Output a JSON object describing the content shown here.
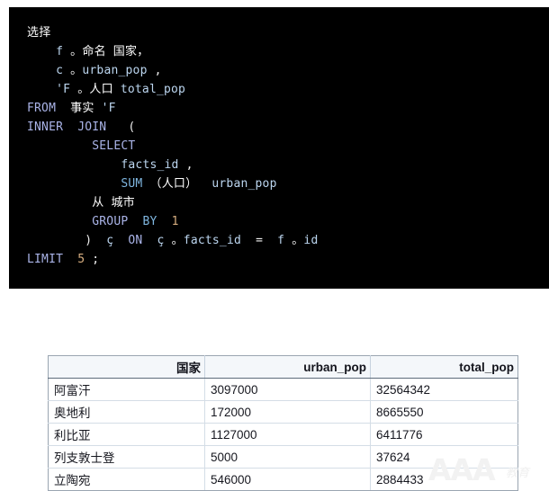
{
  "code_block": {
    "language": "sql",
    "background": "#000000",
    "lines": [
      [
        {
          "t": "选择",
          "c": "tk-cn"
        }
      ],
      [
        {
          "t": "    ",
          "c": "tk-punc"
        },
        {
          "t": "f",
          "c": "tk-id"
        },
        {
          "t": " 。",
          "c": "tk-cn"
        },
        {
          "t": "命名 国家，",
          "c": "tk-cn"
        }
      ],
      [
        {
          "t": "    ",
          "c": "tk-punc"
        },
        {
          "t": "c",
          "c": "tk-id"
        },
        {
          "t": " 。",
          "c": "tk-cn"
        },
        {
          "t": "urban_pop",
          "c": "tk-id"
        },
        {
          "t": " ,",
          "c": "tk-punc"
        }
      ],
      [
        {
          "t": "    ",
          "c": "tk-punc"
        },
        {
          "t": "'F",
          "c": "tk-id"
        },
        {
          "t": " 。",
          "c": "tk-cn"
        },
        {
          "t": "人口",
          "c": "tk-cn"
        },
        {
          "t": " ",
          "c": "tk-punc"
        },
        {
          "t": "total_pop",
          "c": "tk-id"
        }
      ],
      [
        {
          "t": "FROM",
          "c": "tk-kw"
        },
        {
          "t": "  ",
          "c": "tk-punc"
        },
        {
          "t": "事实",
          "c": "tk-cn"
        },
        {
          "t": " ",
          "c": "tk-punc"
        },
        {
          "t": "'F",
          "c": "tk-id"
        }
      ],
      [
        {
          "t": "INNER",
          "c": "tk-kw"
        },
        {
          "t": "  ",
          "c": "tk-punc"
        },
        {
          "t": "JOIN",
          "c": "tk-kw"
        },
        {
          "t": "   (",
          "c": "tk-punc"
        }
      ],
      [
        {
          "t": "         ",
          "c": "tk-punc"
        },
        {
          "t": "SELECT",
          "c": "tk-kw"
        }
      ],
      [
        {
          "t": "             ",
          "c": "tk-punc"
        },
        {
          "t": "facts_id",
          "c": "tk-id"
        },
        {
          "t": " ,",
          "c": "tk-punc"
        }
      ],
      [
        {
          "t": "             ",
          "c": "tk-punc"
        },
        {
          "t": "SUM",
          "c": "tk-kw2"
        },
        {
          "t": " （",
          "c": "tk-cn"
        },
        {
          "t": "人口",
          "c": "tk-cn"
        },
        {
          "t": "）",
          "c": "tk-cn"
        },
        {
          "t": "  ",
          "c": "tk-punc"
        },
        {
          "t": "urban_pop",
          "c": "tk-id"
        }
      ],
      [
        {
          "t": "         ",
          "c": "tk-punc"
        },
        {
          "t": "从 城市",
          "c": "tk-cn"
        }
      ],
      [
        {
          "t": "         ",
          "c": "tk-punc"
        },
        {
          "t": "GROUP",
          "c": "tk-kw"
        },
        {
          "t": "  ",
          "c": "tk-punc"
        },
        {
          "t": "BY",
          "c": "tk-kw2"
        },
        {
          "t": "  ",
          "c": "tk-punc"
        },
        {
          "t": "1",
          "c": "tk-num"
        }
      ],
      [
        {
          "t": "        ",
          "c": "tk-punc"
        },
        {
          "t": ")",
          "c": "tk-punc"
        },
        {
          "t": "  ç",
          "c": "tk-id"
        },
        {
          "t": "  ",
          "c": "tk-punc"
        },
        {
          "t": "ON",
          "c": "tk-kw"
        },
        {
          "t": "  ç",
          "c": "tk-id"
        },
        {
          "t": " 。",
          "c": "tk-cn"
        },
        {
          "t": "facts_id",
          "c": "tk-id"
        },
        {
          "t": "  =  ",
          "c": "tk-punc"
        },
        {
          "t": "f",
          "c": "tk-id"
        },
        {
          "t": " 。",
          "c": "tk-cn"
        },
        {
          "t": "id",
          "c": "tk-id"
        }
      ],
      [
        {
          "t": "LIMIT",
          "c": "tk-kw"
        },
        {
          "t": "  ",
          "c": "tk-punc"
        },
        {
          "t": "5",
          "c": "tk-num"
        },
        {
          "t": " ;",
          "c": "tk-punc"
        }
      ]
    ]
  },
  "result_table": {
    "headers": [
      "国家",
      "urban_pop",
      "total_pop"
    ],
    "rows": [
      [
        "阿富汗",
        "3097000",
        "32564342"
      ],
      [
        "奥地利",
        "172000",
        "8665550"
      ],
      [
        "利比亚",
        "1127000",
        "6411776"
      ],
      [
        "列支敦士登",
        "5000",
        "37624"
      ],
      [
        "立陶宛",
        "546000",
        "2884433"
      ]
    ]
  },
  "watermark": {
    "letters": "AAA",
    "cn": "教育",
    "color": "#f2f2f2"
  }
}
